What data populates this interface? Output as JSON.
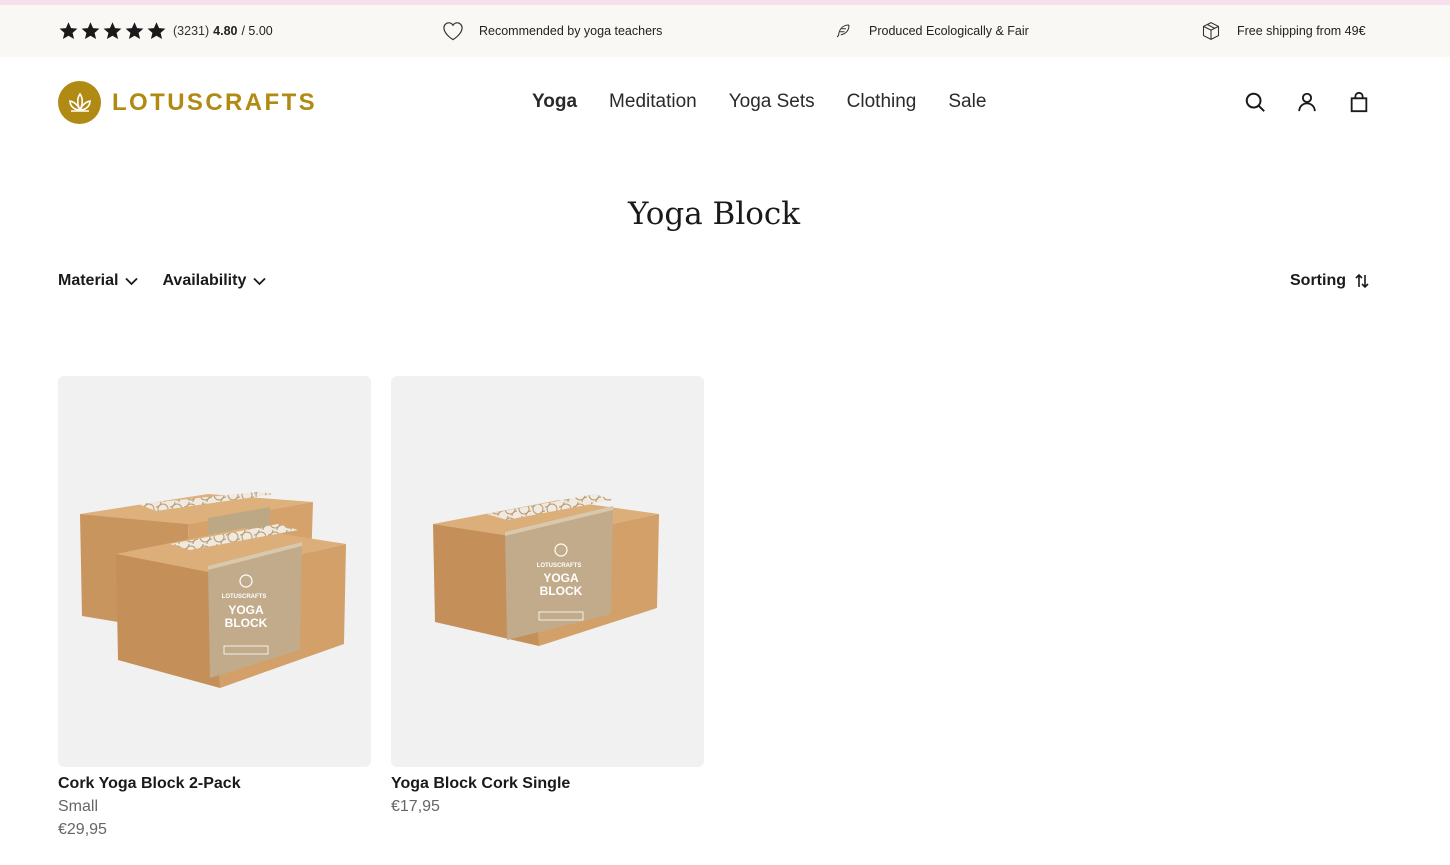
{
  "usp_bar": {
    "rating": {
      "count": "(3231)",
      "score": "4.80",
      "max": "/ 5.00",
      "stars": 5
    },
    "items": [
      {
        "icon": "heart-icon",
        "text": "Recommended by yoga teachers"
      },
      {
        "icon": "feather-icon",
        "text": "Produced Ecologically & Fair"
      },
      {
        "icon": "package-icon",
        "text": "Free shipping from 49€"
      }
    ]
  },
  "header": {
    "logo_text": "LOTUSCRAFTS",
    "nav": [
      {
        "label": "Yoga",
        "active": true
      },
      {
        "label": "Meditation"
      },
      {
        "label": "Yoga Sets"
      },
      {
        "label": "Clothing"
      },
      {
        "label": "Sale"
      }
    ],
    "icons": [
      "search-icon",
      "account-icon",
      "cart-icon"
    ]
  },
  "page": {
    "title": "Yoga Block",
    "filters": [
      {
        "label": "Material"
      },
      {
        "label": "Availability"
      }
    ],
    "sorting_label": "Sorting"
  },
  "products": [
    {
      "name": "Cork Yoga Block 2-Pack",
      "variant": "Small",
      "price": "€29,95",
      "label_line1": "YOGA",
      "label_line2": "BLOCK",
      "brand": "LOTUSCRAFTS"
    },
    {
      "name": "Yoga Block Cork Single",
      "price": "€17,95",
      "label_line1": "YOGA",
      "label_line2": "BLOCK",
      "brand": "LOTUSCRAFTS"
    }
  ],
  "colors": {
    "brand": "#b08a12",
    "cork": "#d1a06e",
    "sleeve": "#c2ad8e",
    "top_bar": "#f9f8f5"
  }
}
